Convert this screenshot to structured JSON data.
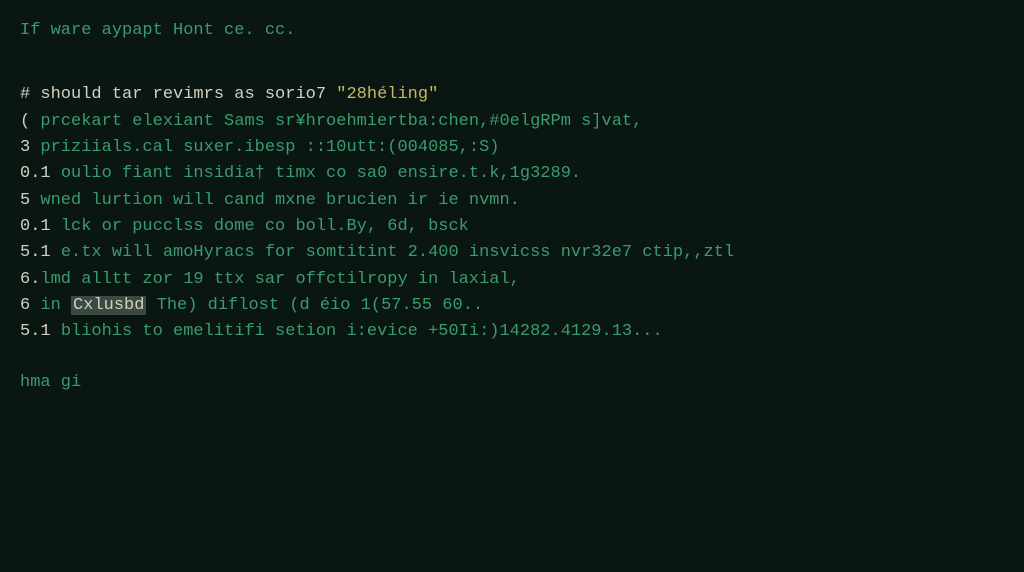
{
  "header": "If ware aypapt Hont ce. cc.",
  "lines": {
    "l1_prefix": "# ",
    "l1_white": "should tar revimrs as sorio7 ",
    "l1_yellow": "\"28héling\"",
    "l2_prefix": "( ",
    "l2_green": "prcekart elexiant Sams sr¥hroehmiertba:chen,#0elgRPm s]vat,",
    "l3_prefix": "3 ",
    "l3_green": "priziials.cal suxer.ibesp ::10utt:(004085,:S)",
    "l4_prefix": "0.1 ",
    "l4_green": "oulio fiant insidia† timx co sa0 ensire.t.k,1g3289.",
    "l5_prefix": "5 ",
    "l5_green": "wned lurtion will cand mxne brucien ir ie nvmn.",
    "l6_prefix": "0.1 ",
    "l6_green": "lck or pucclss dome co boll.By, 6d, bsck",
    "l7_prefix": "5.1 ",
    "l7_green": "e.tx will amoHyracs for somtitint 2.400 insvicss nvr32e7 ctip,,ztl",
    "l8_prefix": "6.",
    "l8_green": "lmd alltt zor 19 ttx sar offctilropy in laxial,",
    "l9_prefix": "6 ",
    "l9_green_a": "in ",
    "l9_selected": "Cxlusbd",
    "l9_green_b": " The) diflost (d éio 1(57.55 60..",
    "l10_prefix": "5.1 ",
    "l10_green": "bliohis to emelitifi setion i:evice +50Ii:)14282.4129.13..."
  },
  "prompt": "hma gi"
}
